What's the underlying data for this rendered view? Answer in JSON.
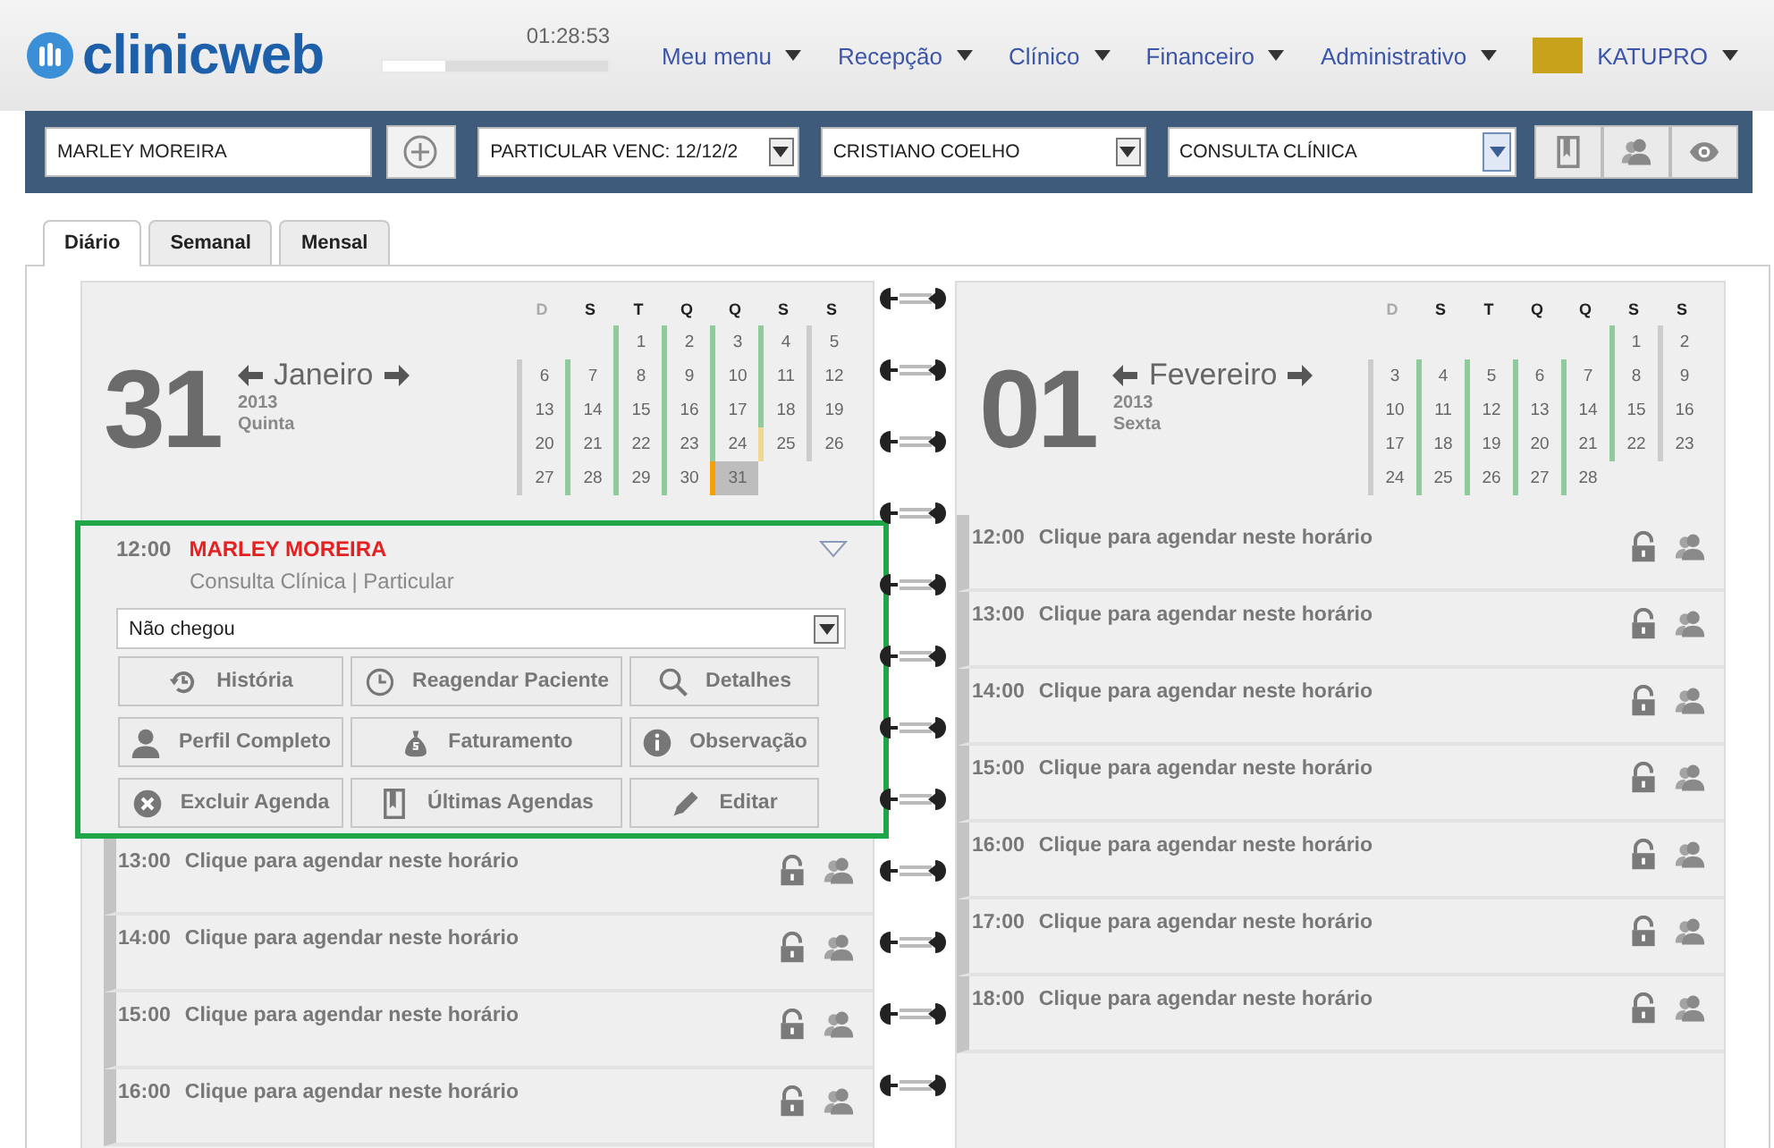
{
  "header": {
    "logo": "clinicweb",
    "timer": {
      "time": "01:28:53",
      "level": 0.28
    },
    "menu": [
      {
        "label": "Meu menu"
      },
      {
        "label": "Recepção"
      },
      {
        "label": "Clínico"
      },
      {
        "label": "Financeiro"
      },
      {
        "label": "Administrativo"
      }
    ],
    "user": {
      "name": "KATUPRO"
    }
  },
  "toolbar": {
    "patient": {
      "value": "MARLEY MOREIRA"
    },
    "selects": [
      {
        "value": "PARTICULAR VENC: 12/12/2",
        "focused": false
      },
      {
        "value": "CRISTIANO COELHO",
        "focused": false
      },
      {
        "value": "CONSULTA CLÍNICA",
        "focused": true
      }
    ],
    "icon_buttons": [
      {
        "kind": "book"
      },
      {
        "kind": "people"
      },
      {
        "kind": "eye"
      }
    ]
  },
  "tabs": [
    {
      "label": "Diário",
      "selected": true
    },
    {
      "label": "Semanal",
      "selected": false
    },
    {
      "label": "Mensal",
      "selected": false
    }
  ],
  "pages": [
    {
      "day": "31",
      "month": "Janeiro",
      "year": "2013",
      "weekday": "Quinta",
      "calendar": {
        "weekdays": [
          "D",
          "S",
          "T",
          "Q",
          "Q",
          "S",
          "S"
        ],
        "weeks": [
          [
            {
              "d": "1",
              "color": "#8fcb9b",
              "selected": false
            },
            {
              "d": "2",
              "color": "#8fcb9b",
              "selected": false
            },
            {
              "d": "3",
              "color": "#8fcb9b",
              "selected": false
            },
            {
              "d": "4",
              "color": "#8fcb9b",
              "selected": false
            },
            {
              "d": "5",
              "color": "#cccccc",
              "selected": false
            }
          ],
          [
            {
              "d": "6",
              "color": "#cccccc",
              "selected": false
            },
            {
              "d": "7",
              "color": "#8fcb9b",
              "selected": false
            },
            {
              "d": "8",
              "color": "#8fcb9b",
              "selected": false
            },
            {
              "d": "9",
              "color": "#8fcb9b",
              "selected": false
            },
            {
              "d": "10",
              "color": "#8fcb9b",
              "selected": false
            },
            {
              "d": "11",
              "color": "#8fcb9b",
              "selected": false
            },
            {
              "d": "12",
              "color": "#cccccc",
              "selected": false
            }
          ],
          [
            {
              "d": "13",
              "color": "#cccccc",
              "selected": false
            },
            {
              "d": "14",
              "color": "#8fcb9b",
              "selected": false
            },
            {
              "d": "15",
              "color": "#8fcb9b",
              "selected": false
            },
            {
              "d": "16",
              "color": "#8fcb9b",
              "selected": false
            },
            {
              "d": "17",
              "color": "#8fcb9b",
              "selected": false
            },
            {
              "d": "18",
              "color": "#8fcb9b",
              "selected": false
            },
            {
              "d": "19",
              "color": "#cccccc",
              "selected": false
            }
          ],
          [
            {
              "d": "20",
              "color": "#cccccc",
              "selected": false
            },
            {
              "d": "21",
              "color": "#8fcb9b",
              "selected": false
            },
            {
              "d": "22",
              "color": "#8fcb9b",
              "selected": false
            },
            {
              "d": "23",
              "color": "#8fcb9b",
              "selected": false
            },
            {
              "d": "24",
              "color": "#8fcb9b",
              "selected": false
            },
            {
              "d": "25",
              "color": "#f0d890",
              "selected": false
            },
            {
              "d": "26",
              "color": "#cccccc",
              "selected": false
            }
          ],
          [
            {
              "d": "27",
              "color": "#cccccc",
              "selected": false
            },
            {
              "d": "28",
              "color": "#8fcb9b",
              "selected": false
            },
            {
              "d": "29",
              "color": "#8fcb9b",
              "selected": false
            },
            {
              "d": "30",
              "color": "#8fcb9b",
              "selected": false
            },
            {
              "d": "31",
              "color": "#f5a000",
              "selected": true
            }
          ]
        ]
      },
      "slots": [
        {
          "kind": "appointment",
          "time": "12:00",
          "patient": "MARLEY MOREIRA",
          "detail": "Consulta Clínica | Particular",
          "status": "Não chegou",
          "actions": [
            {
              "label": "História",
              "kind": "history"
            },
            {
              "label": "Reagendar Paciente",
              "kind": "clock"
            },
            {
              "label": "Detalhes",
              "kind": "search"
            },
            {
              "label": "Perfil Completo",
              "kind": "person"
            },
            {
              "label": "Faturamento",
              "kind": "moneybag"
            },
            {
              "label": "Observação",
              "kind": "info"
            },
            {
              "label": "Excluir Agenda",
              "kind": "delete"
            },
            {
              "label": "Últimas Agendas",
              "kind": "book"
            },
            {
              "label": "Editar",
              "kind": "pencil"
            }
          ]
        },
        {
          "kind": "free",
          "time": "13:00",
          "text": "Clique para agendar neste horário"
        },
        {
          "kind": "free",
          "time": "14:00",
          "text": "Clique para agendar neste horário"
        },
        {
          "kind": "free",
          "time": "15:00",
          "text": "Clique para agendar neste horário"
        },
        {
          "kind": "free",
          "time": "16:00",
          "text": "Clique para agendar neste horário"
        }
      ]
    },
    {
      "day": "01",
      "month": "Fevereiro",
      "year": "2013",
      "weekday": "Sexta",
      "calendar": {
        "weekdays": [
          "D",
          "S",
          "T",
          "Q",
          "Q",
          "S",
          "S"
        ],
        "weeks": [
          [
            {
              "d": "1",
              "color": "#8fcb9b",
              "selected": false
            },
            {
              "d": "2",
              "color": "#cccccc",
              "selected": false
            }
          ],
          [
            {
              "d": "3",
              "color": "#cccccc",
              "selected": false
            },
            {
              "d": "4",
              "color": "#8fcb9b",
              "selected": false
            },
            {
              "d": "5",
              "color": "#8fcb9b",
              "selected": false
            },
            {
              "d": "6",
              "color": "#8fcb9b",
              "selected": false
            },
            {
              "d": "7",
              "color": "#8fcb9b",
              "selected": false
            },
            {
              "d": "8",
              "color": "#8fcb9b",
              "selected": false
            },
            {
              "d": "9",
              "color": "#cccccc",
              "selected": false
            }
          ],
          [
            {
              "d": "10",
              "color": "#cccccc",
              "selected": false
            },
            {
              "d": "11",
              "color": "#8fcb9b",
              "selected": false
            },
            {
              "d": "12",
              "color": "#8fcb9b",
              "selected": false
            },
            {
              "d": "13",
              "color": "#8fcb9b",
              "selected": false
            },
            {
              "d": "14",
              "color": "#8fcb9b",
              "selected": false
            },
            {
              "d": "15",
              "color": "#8fcb9b",
              "selected": false
            },
            {
              "d": "16",
              "color": "#cccccc",
              "selected": false
            }
          ],
          [
            {
              "d": "17",
              "color": "#cccccc",
              "selected": false
            },
            {
              "d": "18",
              "color": "#8fcb9b",
              "selected": false
            },
            {
              "d": "19",
              "color": "#8fcb9b",
              "selected": false
            },
            {
              "d": "20",
              "color": "#8fcb9b",
              "selected": false
            },
            {
              "d": "21",
              "color": "#8fcb9b",
              "selected": false
            },
            {
              "d": "22",
              "color": "#8fcb9b",
              "selected": false
            },
            {
              "d": "23",
              "color": "#cccccc",
              "selected": false
            }
          ],
          [
            {
              "d": "24",
              "color": "#cccccc",
              "selected": false
            },
            {
              "d": "25",
              "color": "#8fcb9b",
              "selected": false
            },
            {
              "d": "26",
              "color": "#8fcb9b",
              "selected": false
            },
            {
              "d": "27",
              "color": "#8fcb9b",
              "selected": false
            },
            {
              "d": "28",
              "color": "#8fcb9b",
              "selected": false
            }
          ]
        ]
      },
      "slots": [
        {
          "kind": "free",
          "time": "12:00",
          "text": "Clique para agendar neste horário"
        },
        {
          "kind": "free",
          "time": "13:00",
          "text": "Clique para agendar neste horário"
        },
        {
          "kind": "free",
          "time": "14:00",
          "text": "Clique para agendar neste horário"
        },
        {
          "kind": "free",
          "time": "15:00",
          "text": "Clique para agendar neste horário"
        },
        {
          "kind": "free",
          "time": "16:00",
          "text": "Clique para agendar neste horário"
        },
        {
          "kind": "free",
          "time": "17:00",
          "text": "Clique para agendar neste horário"
        },
        {
          "kind": "free",
          "time": "18:00",
          "text": "Clique para agendar neste horário"
        }
      ]
    }
  ]
}
